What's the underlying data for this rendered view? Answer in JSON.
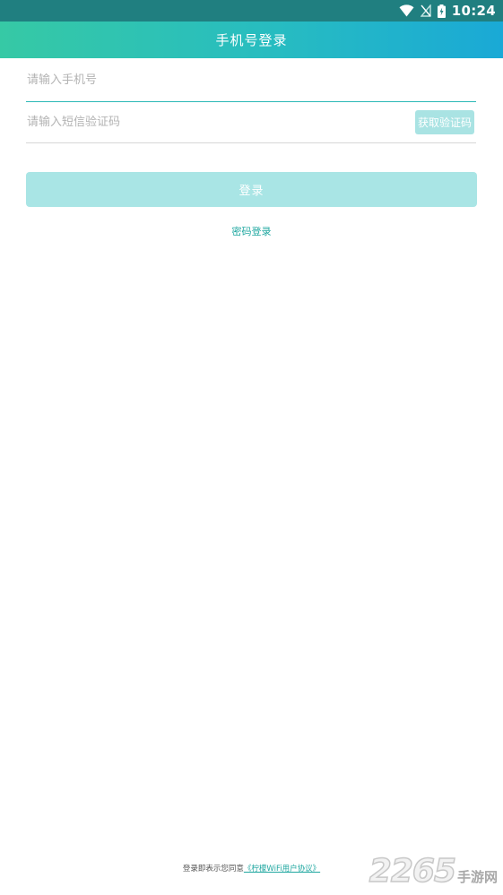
{
  "status_bar": {
    "time": "10:24",
    "icons": [
      "wifi-icon",
      "no-signal-icon",
      "battery-charging-icon"
    ]
  },
  "header": {
    "title": "手机号登录"
  },
  "form": {
    "phone_placeholder": "请输入手机号",
    "phone_value": "",
    "code_placeholder": "请输入短信验证码",
    "code_value": "",
    "get_code_label": "获取验证码",
    "login_label": "登录",
    "password_login_label": "密码登录"
  },
  "agreement": {
    "prefix": "登录即表示您同意",
    "link": "《柠檬WiFi用户协议》"
  },
  "watermark": {
    "number": "2265",
    "text": "手游网"
  },
  "colors": {
    "header_gradient_start": "#36c9a5",
    "header_gradient_end": "#1aa9d6",
    "accent": "#1fa7a0",
    "button_disabled": "#a9e5e5",
    "input_underline_active": "#2bb9b6"
  }
}
